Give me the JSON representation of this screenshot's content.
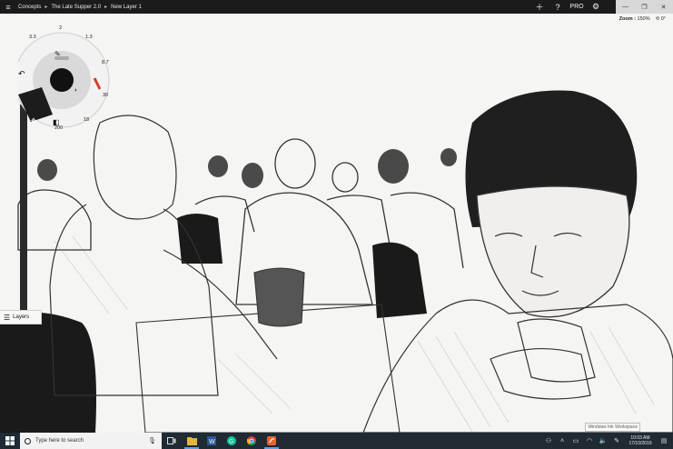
{
  "titlebar": {
    "breadcrumbs": [
      "Concepts",
      "The Late Supper 2.0",
      "New Layer 1"
    ],
    "pro_label": "PRO"
  },
  "canvas": {
    "zoom_label": "Zoom :",
    "zoom_value": "150%",
    "rotation": "0°",
    "layers_label": "Layers",
    "watermark": "Windows Ink Workspace"
  },
  "tool_wheel": {
    "labels": [
      "3.3",
      "2",
      "1.3",
      "8.7",
      "30",
      "18",
      "200"
    ]
  },
  "taskbar": {
    "search_placeholder": "Type here to search",
    "time": "10:03 AM",
    "date": "17/10/2019",
    "accent_color": "#5ba0e6"
  }
}
